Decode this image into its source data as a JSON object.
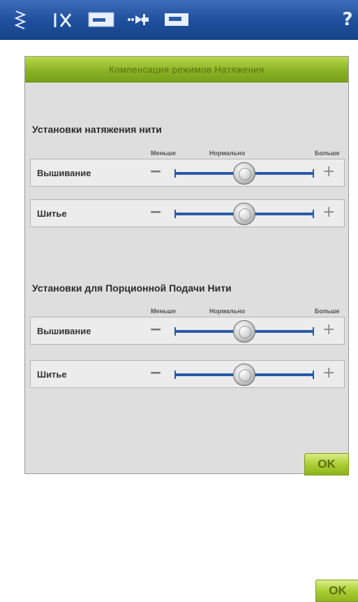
{
  "toolbar": {
    "icons": [
      "stitch-zigzag-icon",
      "needle-position-icon",
      "presser-foot-icon",
      "thread-cutter-icon",
      "machine-icon",
      "help-icon"
    ],
    "help_label": "?"
  },
  "dialog": {
    "title": "Компенсация режимов Натяжения",
    "sections": [
      {
        "title": "Установки натяжения нити",
        "scale": {
          "less": "Меньше",
          "normal": "Нормально",
          "more": "Больше"
        },
        "rows": [
          {
            "label": "Вышивание",
            "value": 0.5
          },
          {
            "label": "Шитье",
            "value": 0.5
          }
        ]
      },
      {
        "title": "Установки для Порционной Подачи Нити",
        "scale": {
          "less": "Меньше",
          "normal": "Нормально",
          "more": "Больше"
        },
        "rows": [
          {
            "label": "Вышивание",
            "value": 0.5
          },
          {
            "label": "Шитье",
            "value": 0.5
          }
        ]
      }
    ],
    "ok_label": "OK"
  },
  "page": {
    "ok_label": "OK"
  },
  "colors": {
    "toolbar": "#1f4f9c",
    "accent_green": "#8bb325",
    "slider_track": "#2a5aa8"
  }
}
